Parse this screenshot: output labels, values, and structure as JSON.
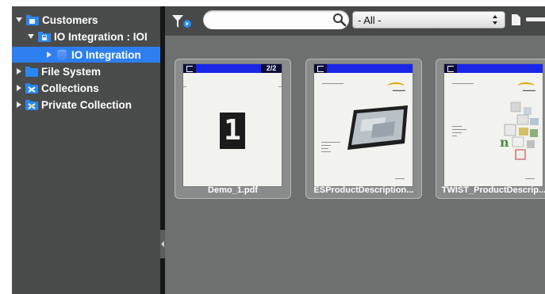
{
  "sidebar": {
    "items": [
      {
        "label": "Customers",
        "icon": "customers-folder-icon",
        "expanded": true
      },
      {
        "label": "IO Integration : IOI",
        "icon": "integration-folder-icon",
        "expanded": true
      },
      {
        "label": "IO Integration",
        "icon": "database-icon",
        "expanded": false,
        "selected": true
      },
      {
        "label": "File System",
        "icon": "blue-folder-icon",
        "expanded": false
      },
      {
        "label": "Collections",
        "icon": "collections-folder-icon",
        "expanded": false
      },
      {
        "label": "Private Collection",
        "icon": "private-collection-folder-icon",
        "expanded": false
      }
    ]
  },
  "toolbar": {
    "search_value": "",
    "filter_value": "- All -"
  },
  "documents": [
    {
      "name": "Demo_1.pdf",
      "page": "2/2",
      "glyph": "1"
    },
    {
      "name": "ESProductDescription..."
    },
    {
      "name": "TWIST_ProductDescrip..."
    }
  ],
  "colors": {
    "sidebar_bg": "#4a4b4b",
    "selection": "#2d7ff0",
    "content_bg": "#6e6f6f",
    "toolbar_bg": "#474848",
    "thumb_header": "#1a26e6"
  }
}
